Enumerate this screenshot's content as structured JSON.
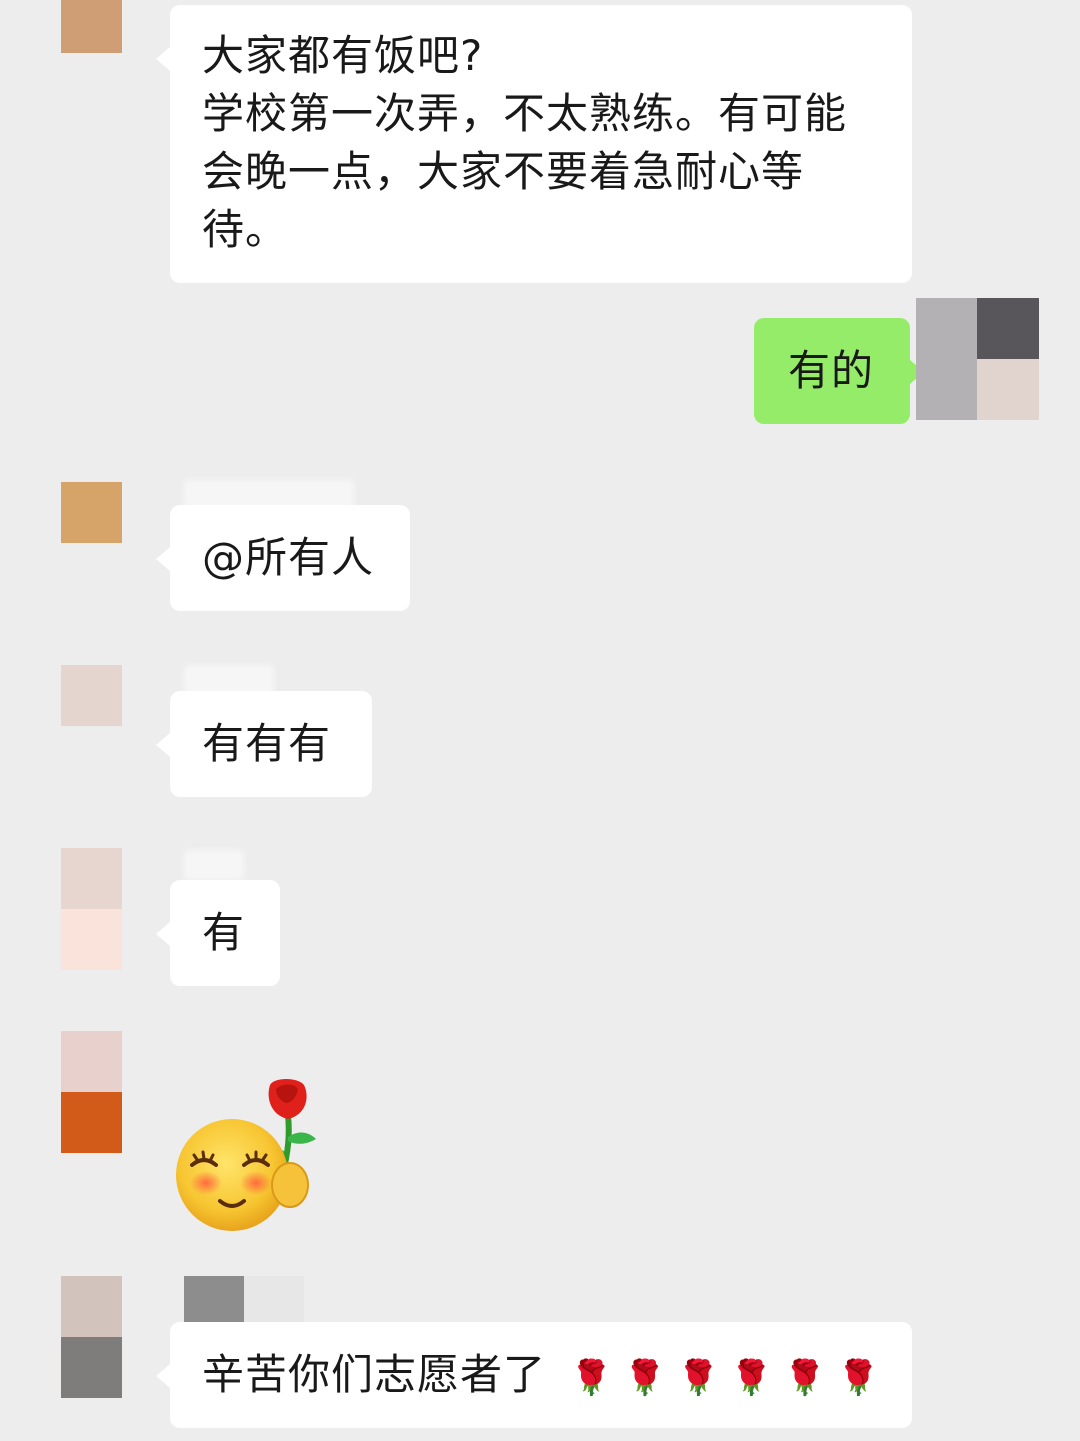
{
  "messages": [
    {
      "side": "left",
      "lines": [
        "大家都有饭吧?",
        "学校第一次弄，不太熟练。有可能",
        "会晚一点，大家不要着急耐心等",
        "待。"
      ]
    },
    {
      "side": "right",
      "text": "有的"
    },
    {
      "side": "left",
      "text": "@所有人"
    },
    {
      "side": "left",
      "text": "有有有"
    },
    {
      "side": "left",
      "text": "有"
    },
    {
      "side": "left",
      "sticker": "smiling-face-holding-rose"
    },
    {
      "side": "left",
      "text": "辛苦你们志愿者了",
      "trailing_icons": [
        "rose-icon",
        "rose-icon",
        "rose-icon",
        "rose-icon",
        "rose-icon",
        "rose-icon"
      ]
    }
  ],
  "rose_glyph": "🌹",
  "colors": {
    "background": "#ededed",
    "bubble_in": "#ffffff",
    "bubble_out": "#95ec69"
  }
}
